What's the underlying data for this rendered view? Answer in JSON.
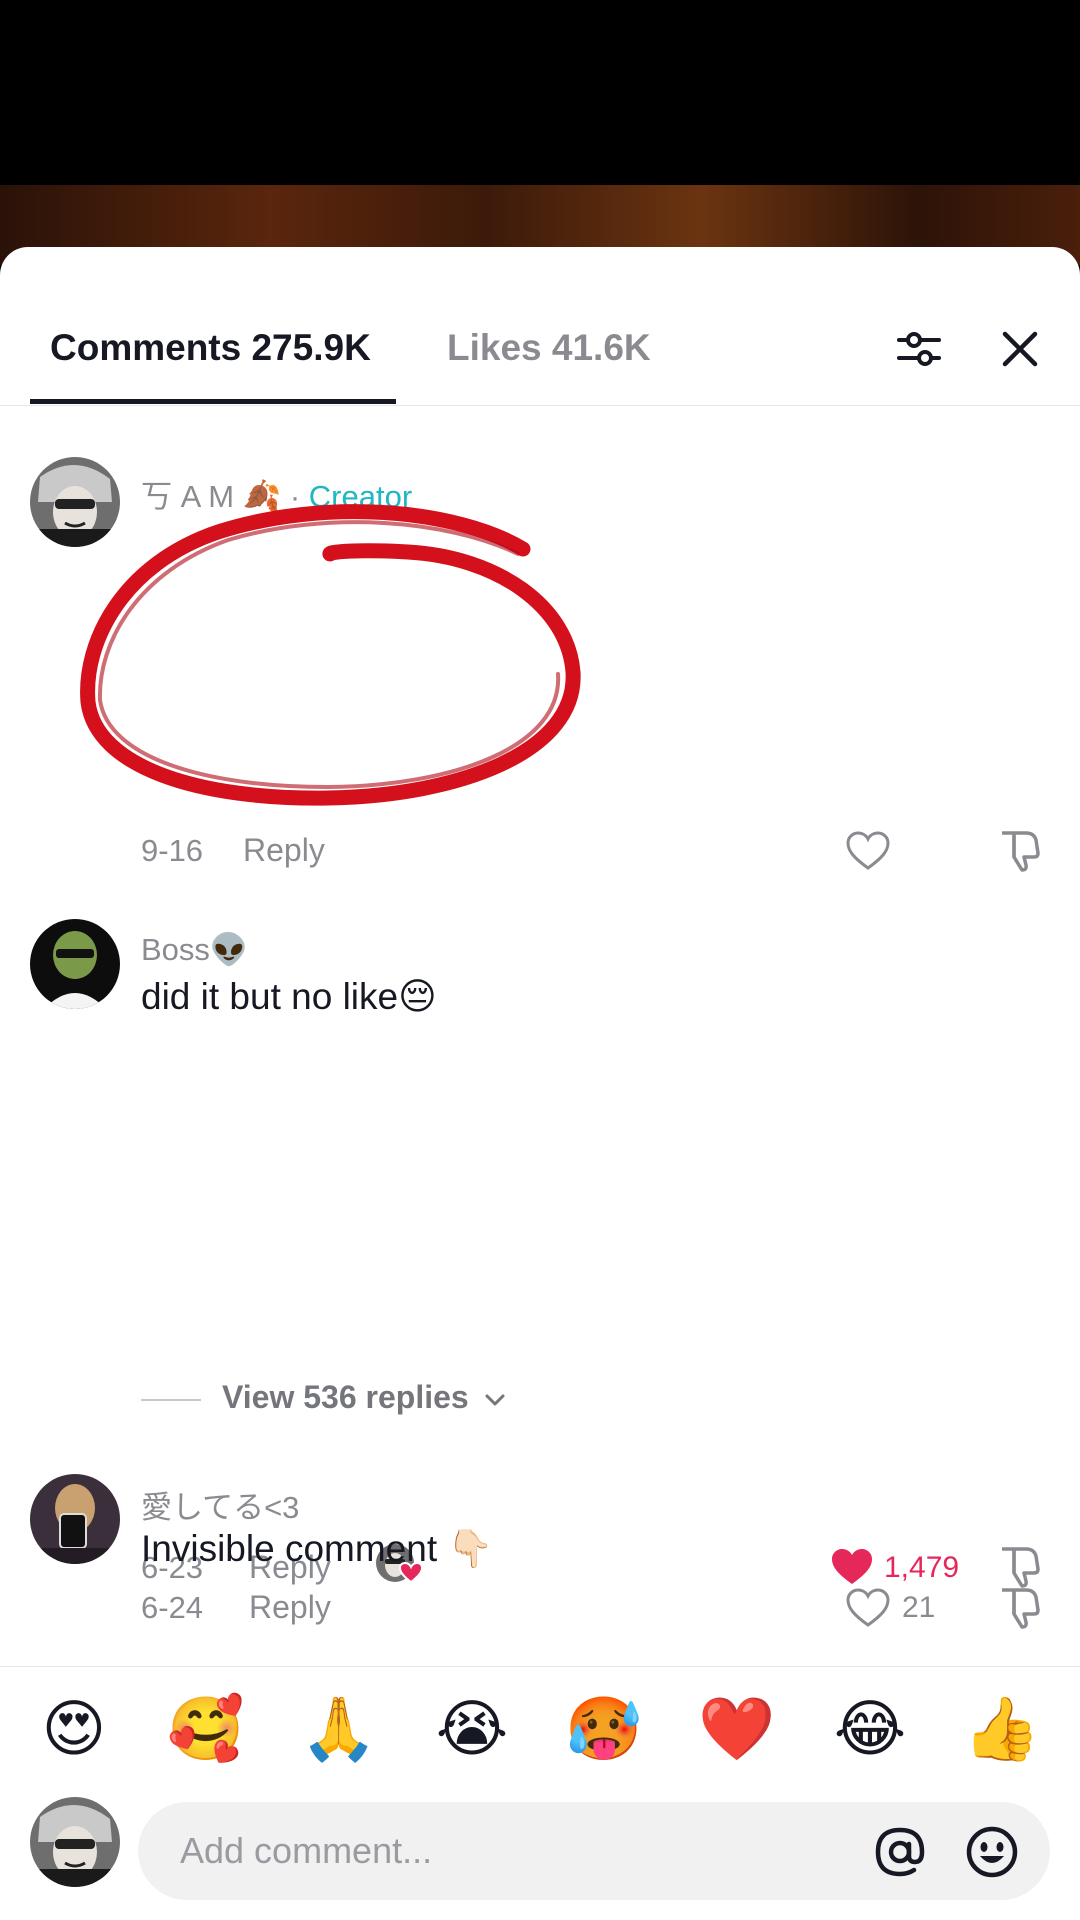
{
  "tabs": {
    "comments": "Comments 275.9K",
    "likes": "Likes 41.6K"
  },
  "comments": [
    {
      "username": "丂 A M 🍂",
      "separator": " · ",
      "badge": "Creator",
      "text": "",
      "date": "9-16",
      "reply": "Reply",
      "likes": ""
    },
    {
      "username": "Boss👽",
      "text": "did it but no like😔",
      "date": "6-23",
      "reply": "Reply",
      "likes": "1,479"
    },
    {
      "username": "愛してる<3",
      "text": "Invisible comment 👇🏻",
      "date": "6-24",
      "reply": "Reply",
      "likes": "21"
    }
  ],
  "view_replies": "View 536 replies",
  "reactions": [
    "😍",
    "🥰",
    "🙏",
    "😭",
    "🥵",
    "❤️",
    "😂",
    "👍"
  ],
  "input": {
    "placeholder": "Add comment..."
  },
  "colors": {
    "creator": "#20b6c4",
    "liked": "#e6275a",
    "annotation": "#d4101c"
  },
  "icons": [
    "filter-icon",
    "close-icon",
    "heart-icon",
    "dislike-icon",
    "at-icon",
    "emoji-icon",
    "chevron-down-icon"
  ]
}
